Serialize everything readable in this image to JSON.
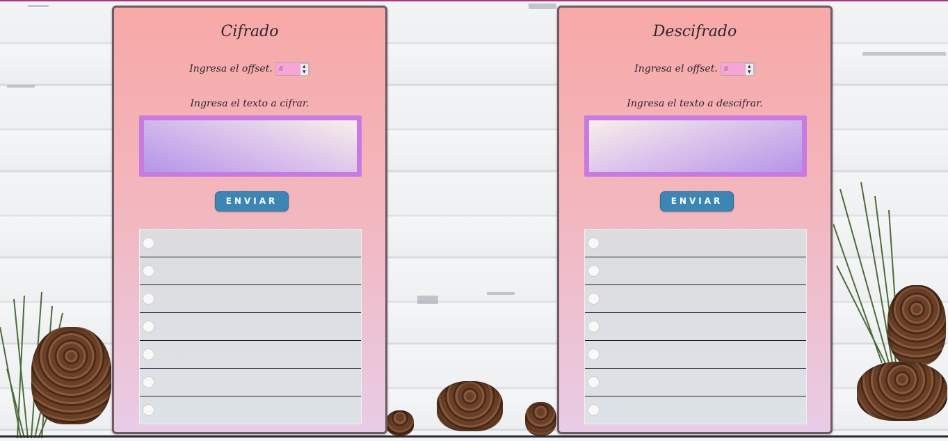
{
  "left_panel": {
    "title": "Cifrado",
    "offset_label": "Ingresa el offset.",
    "offset_placeholder": "#",
    "text_label": "Ingresa el texto a cifrar.",
    "button_label": "ENVIAR",
    "result_rows": [
      "",
      "",
      "",
      "",
      "",
      "",
      ""
    ]
  },
  "right_panel": {
    "title": "Descifrado",
    "offset_label": "Ingresa el offset.",
    "offset_placeholder": "#",
    "text_label": "Ingresa el texto a descifrar.",
    "button_label": "ENVIAR",
    "result_rows": [
      "",
      "",
      "",
      "",
      "",
      "",
      ""
    ]
  },
  "colors": {
    "button": "#3b86b5",
    "panel_top": "#f7a9a7",
    "panel_bottom": "#e8cce6",
    "textarea_border": "#c77ae0"
  },
  "icons": {
    "spinner": "up-down-arrows-icon",
    "radio": "radio-circle-icon"
  }
}
